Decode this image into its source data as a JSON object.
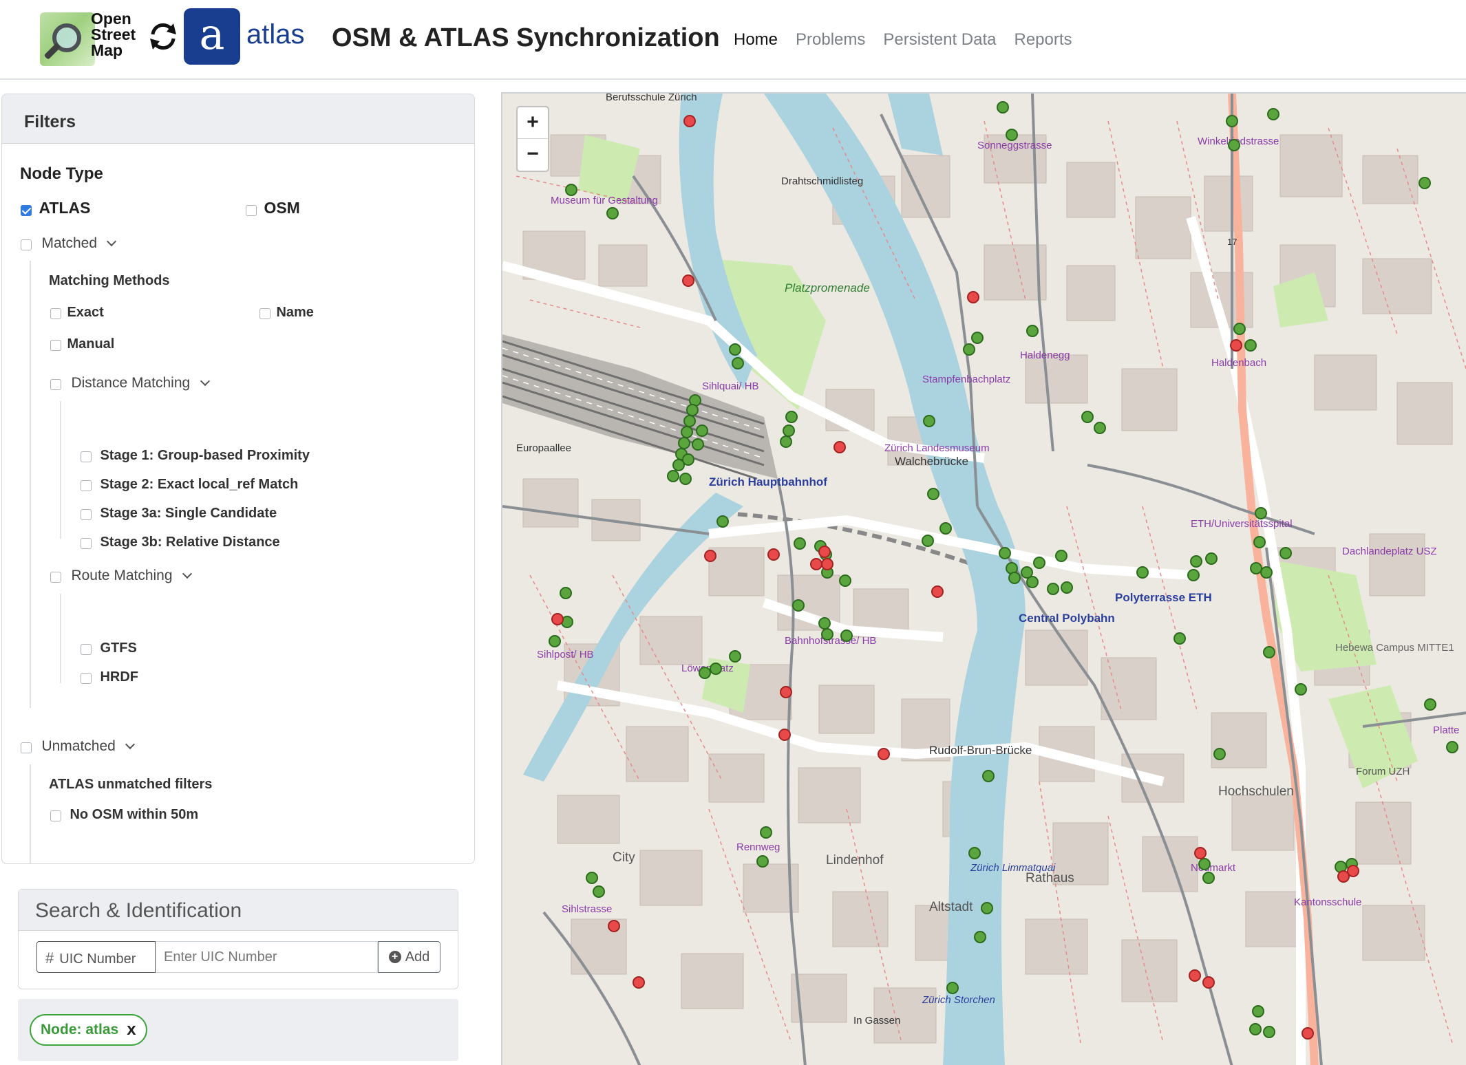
{
  "header": {
    "osm_logo_text": "Open Street Map",
    "atlas_letter": "a",
    "atlas_word": "atlas",
    "title": "OSM & ATLAS Synchronization",
    "nav": [
      {
        "label": "Home",
        "active": true
      },
      {
        "label": "Problems",
        "active": false
      },
      {
        "label": "Persistent Data",
        "active": false
      },
      {
        "label": "Reports",
        "active": false
      }
    ]
  },
  "filters": {
    "title": "Filters",
    "node_type": {
      "heading": "Node Type",
      "atlas": {
        "label": "ATLAS",
        "checked": true
      },
      "osm": {
        "label": "OSM",
        "checked": false
      }
    },
    "matched": {
      "label": "Matched",
      "methods_heading": "Matching Methods",
      "exact": "Exact",
      "name": "Name",
      "manual": "Manual",
      "distance": {
        "label": "Distance Matching",
        "stage1": "Stage 1: Group-based Proximity",
        "stage2": "Stage 2: Exact local_ref Match",
        "stage3a": "Stage 3a: Single Candidate",
        "stage3b": "Stage 3b: Relative Distance"
      },
      "route": {
        "label": "Route Matching",
        "gtfs": "GTFS",
        "hrdf": "HRDF"
      }
    },
    "unmatched": {
      "label": "Unmatched",
      "atlas_heading": "ATLAS unmatched filters",
      "no_osm": "No OSM within 50m"
    }
  },
  "search": {
    "title": "Search & Identification",
    "prefix_symbol": "#",
    "prefix_label": "UIC Number",
    "placeholder": "Enter UIC Number",
    "add_label": "Add",
    "active_tag": "Node: atlas",
    "remove_symbol": "x"
  },
  "map": {
    "zoom_in": "+",
    "zoom_out": "−",
    "labels": {
      "berufsschule": "Berufsschule Zürich",
      "drahtschmidli": "Drahtschmidlisteg",
      "platzpromenade": "Platzpromenade",
      "museum": "Museum für Gestaltung",
      "sonneggstrasse": "Sonneggstrasse",
      "winkelriedstrasse": "Winkelriedstrasse",
      "haldenegg": "Haldenegg",
      "haldenbach": "Haldenbach",
      "stampfenbachplatz": "Stampfenbachplatz",
      "sihlquai_hb": "Sihlquai/ HB",
      "hauptbahnhof": "Zürich Hauptbahnhof",
      "landesmuseum": "Zürich Landesmuseum",
      "walchebruecke": "Walchebrücke",
      "europaallee": "Europaallee",
      "eth_uni": "ETH/Universitätsspital",
      "polyterrasse": "Polyterrasse ETH",
      "central_polybahn": "Central Polybahn",
      "dachlandeplatz": "Dachlandeplatz USZ",
      "bahnhofstrasse_hb": "Bahnhofstrasse/ HB",
      "loewenplatz": "Löwenplatz",
      "sihlpost": "Sihlpost/ HB",
      "rudolf_brun": "Rudolf-Brun-Brücke",
      "hochschulen": "Hochschulen",
      "forum_uzh": "Forum UZH",
      "rennweg": "Rennweg",
      "lindenhof": "Lindenhof",
      "rathaus": "Rathaus",
      "altstadt": "Altstadt",
      "city": "City",
      "neumarkt": "Neumarkt",
      "kantonsschule": "Kantonsschule",
      "zuerich_limmatquai": "Zürich Limmatquai",
      "zuerich_storchen": "Zürich Storchen",
      "nebenbahnhof_campus": "Hebewa Campus MITTE1",
      "route17": "17",
      "platte": "Platte",
      "sihlstrasse": "Sihlstrasse",
      "in_gassen": "In Gassen"
    },
    "colors": {
      "matched_marker": "#5aa53e",
      "unmatched_marker": "#e84a4a",
      "water": "#aad3df",
      "park": "#cdebb0",
      "building": "#d9d0c9"
    }
  }
}
